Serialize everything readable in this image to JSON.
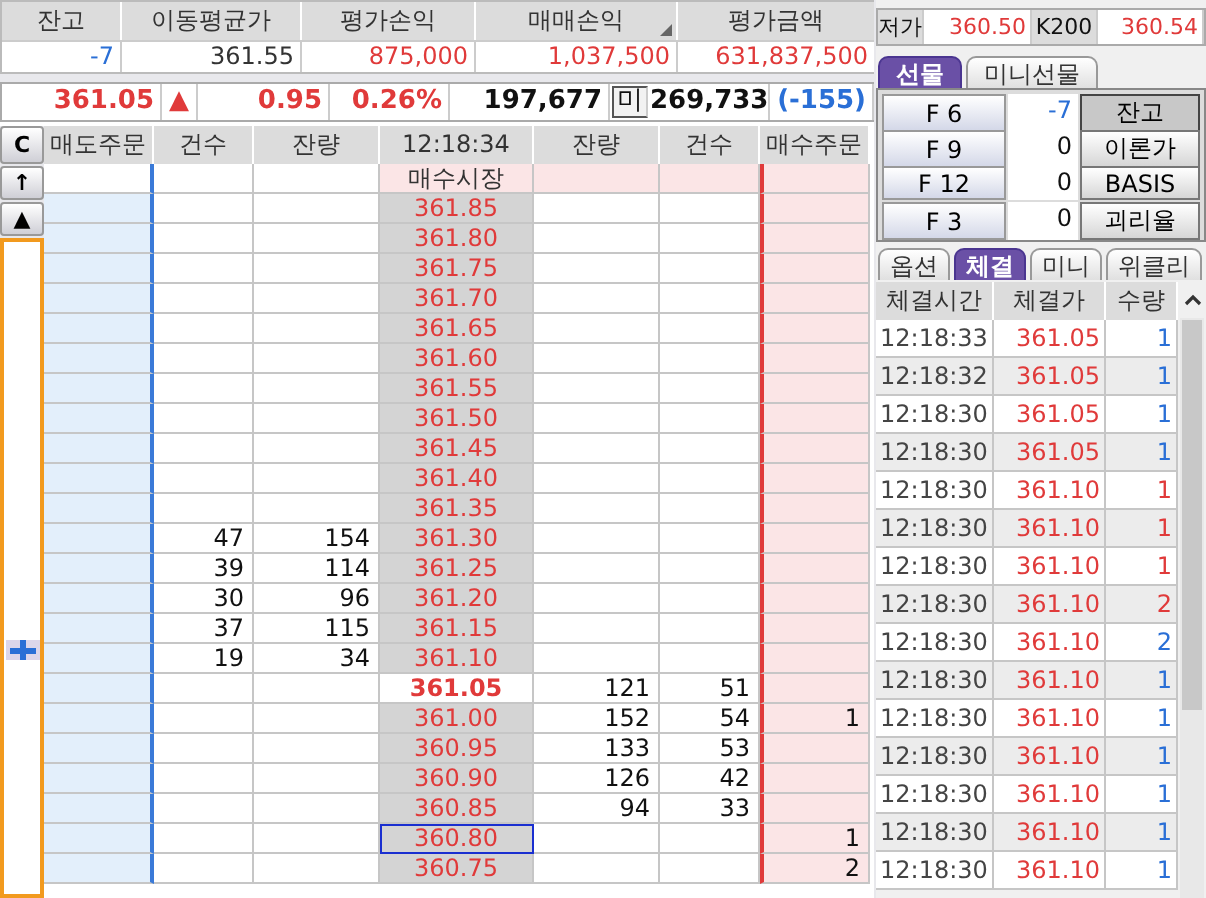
{
  "summary": {
    "columns": [
      "잔고",
      "이동평균가",
      "평가손익",
      "매매손익",
      "평가금액"
    ],
    "values": [
      {
        "text": "-7",
        "color": "#2a6fd6"
      },
      {
        "text": "361.55",
        "color": "#333333"
      },
      {
        "text": "875,000",
        "color": "#e03a3a"
      },
      {
        "text": "1,037,500",
        "color": "#e03a3a"
      },
      {
        "text": "631,837,500",
        "color": "#e03a3a"
      }
    ]
  },
  "quote": {
    "price": "361.05",
    "arrow": "▲",
    "change": "0.95",
    "rate": "0.26%",
    "volume": "197,677",
    "open_label": "미",
    "open_interest": "269,733",
    "oi_change": "(-155)"
  },
  "order_book": {
    "corner_button": "C",
    "up_button": "↑",
    "top_button": "▲",
    "columns": [
      "매도주문",
      "건수",
      "잔량",
      "12:18:34",
      "잔량",
      "건수",
      "매수주문"
    ],
    "rows": [
      {
        "kind": "market",
        "price": "매수시장"
      },
      {
        "kind": "price",
        "price": "361.85",
        "current": false,
        "selected": false
      },
      {
        "kind": "price",
        "price": "361.80",
        "current": false,
        "selected": false
      },
      {
        "kind": "price",
        "price": "361.75",
        "current": false,
        "selected": false
      },
      {
        "kind": "price",
        "price": "361.70",
        "current": false,
        "selected": false
      },
      {
        "kind": "price",
        "price": "361.65",
        "current": false,
        "selected": false
      },
      {
        "kind": "price",
        "price": "361.60",
        "current": false,
        "selected": false
      },
      {
        "kind": "price",
        "price": "361.55",
        "current": false,
        "selected": false
      },
      {
        "kind": "price",
        "price": "361.50",
        "current": false,
        "selected": false
      },
      {
        "kind": "price",
        "price": "361.45",
        "current": false,
        "selected": false
      },
      {
        "kind": "price",
        "price": "361.40",
        "current": false,
        "selected": false
      },
      {
        "kind": "price",
        "price": "361.35",
        "current": false,
        "selected": false
      },
      {
        "kind": "price",
        "price": "361.30",
        "ask_count": "47",
        "ask_qty": "154",
        "current": false,
        "selected": false
      },
      {
        "kind": "price",
        "price": "361.25",
        "ask_count": "39",
        "ask_qty": "114",
        "current": false,
        "selected": false
      },
      {
        "kind": "price",
        "price": "361.20",
        "ask_count": "30",
        "ask_qty": "96",
        "current": false,
        "selected": false
      },
      {
        "kind": "price",
        "price": "361.15",
        "ask_count": "37",
        "ask_qty": "115",
        "current": false,
        "selected": false
      },
      {
        "kind": "price",
        "price": "361.10",
        "ask_count": "19",
        "ask_qty": "34",
        "current": false,
        "selected": false
      },
      {
        "kind": "price",
        "price": "361.05",
        "bid_qty": "121",
        "bid_count": "51",
        "current": true,
        "selected": false
      },
      {
        "kind": "price",
        "price": "361.00",
        "bid_qty": "152",
        "bid_count": "54",
        "buy_order": "1",
        "current": false,
        "selected": false
      },
      {
        "kind": "price",
        "price": "360.95",
        "bid_qty": "133",
        "bid_count": "53",
        "current": false,
        "selected": false
      },
      {
        "kind": "price",
        "price": "360.90",
        "bid_qty": "126",
        "bid_count": "42",
        "current": false,
        "selected": false
      },
      {
        "kind": "price",
        "price": "360.85",
        "bid_qty": "94",
        "bid_count": "33",
        "current": false,
        "selected": false
      },
      {
        "kind": "price",
        "price": "360.80",
        "buy_order": "1",
        "current": false,
        "selected": true
      },
      {
        "kind": "price",
        "price": "360.75",
        "buy_order": "2",
        "current": false,
        "selected": false
      }
    ]
  },
  "info_row": [
    {
      "label": "저가",
      "value": "360.50"
    },
    {
      "label": "K200",
      "value": "360.54"
    }
  ],
  "product_tabs": [
    {
      "label": "선물",
      "selected": true
    },
    {
      "label": "미니선물",
      "selected": false
    }
  ],
  "contracts": [
    {
      "code": "F 6",
      "value": "-7",
      "color": "#2a6fd6",
      "button": "잔고",
      "pressed": true
    },
    {
      "code": "F 9",
      "value": "0",
      "color": "#111111",
      "button": "이론가",
      "pressed": false
    },
    {
      "code": "F 12",
      "value": "0",
      "color": "#111111",
      "button": "BASIS",
      "pressed": false
    },
    {
      "code": "F 3",
      "value": "0",
      "color": "#111111",
      "button": "괴리율",
      "pressed": false
    }
  ],
  "trade_tabs": [
    {
      "label": "옵션",
      "selected": false
    },
    {
      "label": "체결",
      "selected": true
    },
    {
      "label": "미니",
      "selected": false
    },
    {
      "label": "위클리",
      "selected": false
    }
  ],
  "trades": {
    "columns": [
      "체결시간",
      "체결가",
      "수량"
    ],
    "rows": [
      {
        "time": "12:18:33",
        "price": "361.05",
        "qty": "1",
        "color": "#2a6fd6"
      },
      {
        "time": "12:18:32",
        "price": "361.05",
        "qty": "1",
        "color": "#2a6fd6"
      },
      {
        "time": "12:18:30",
        "price": "361.05",
        "qty": "1",
        "color": "#2a6fd6"
      },
      {
        "time": "12:18:30",
        "price": "361.05",
        "qty": "1",
        "color": "#2a6fd6"
      },
      {
        "time": "12:18:30",
        "price": "361.10",
        "qty": "1",
        "color": "#e03a3a"
      },
      {
        "time": "12:18:30",
        "price": "361.10",
        "qty": "1",
        "color": "#e03a3a"
      },
      {
        "time": "12:18:30",
        "price": "361.10",
        "qty": "1",
        "color": "#e03a3a"
      },
      {
        "time": "12:18:30",
        "price": "361.10",
        "qty": "2",
        "color": "#e03a3a"
      },
      {
        "time": "12:18:30",
        "price": "361.10",
        "qty": "2",
        "color": "#2a6fd6"
      },
      {
        "time": "12:18:30",
        "price": "361.10",
        "qty": "1",
        "color": "#2a6fd6"
      },
      {
        "time": "12:18:30",
        "price": "361.10",
        "qty": "1",
        "color": "#2a6fd6"
      },
      {
        "time": "12:18:30",
        "price": "361.10",
        "qty": "1",
        "color": "#2a6fd6"
      },
      {
        "time": "12:18:30",
        "price": "361.10",
        "qty": "1",
        "color": "#2a6fd6"
      },
      {
        "time": "12:18:30",
        "price": "361.10",
        "qty": "1",
        "color": "#2a6fd6"
      },
      {
        "time": "12:18:30",
        "price": "361.10",
        "qty": "1",
        "color": "#2a6fd6"
      }
    ]
  }
}
